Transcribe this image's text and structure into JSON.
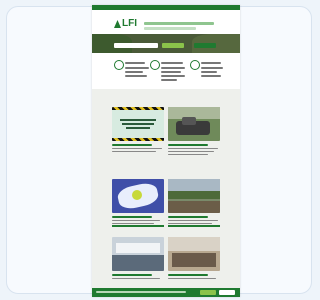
{
  "site": {
    "logo_text": "LFI",
    "colors": {
      "brand": "#1f7a30",
      "accent": "#8bc34a",
      "background": "#eef4fa"
    }
  },
  "quick_links": [
    {
      "icon": "leaf-icon"
    },
    {
      "icon": "globe-icon"
    },
    {
      "icon": "document-icon"
    }
  ],
  "news": [
    {
      "image": "banner-image"
    },
    {
      "image": "machinery-image"
    },
    {
      "image": "graphic-image"
    },
    {
      "image": "forest-group-image"
    },
    {
      "image": "event-image"
    },
    {
      "image": "meeting-image"
    }
  ],
  "footer": {
    "buttons": [
      "accept",
      "decline"
    ]
  }
}
